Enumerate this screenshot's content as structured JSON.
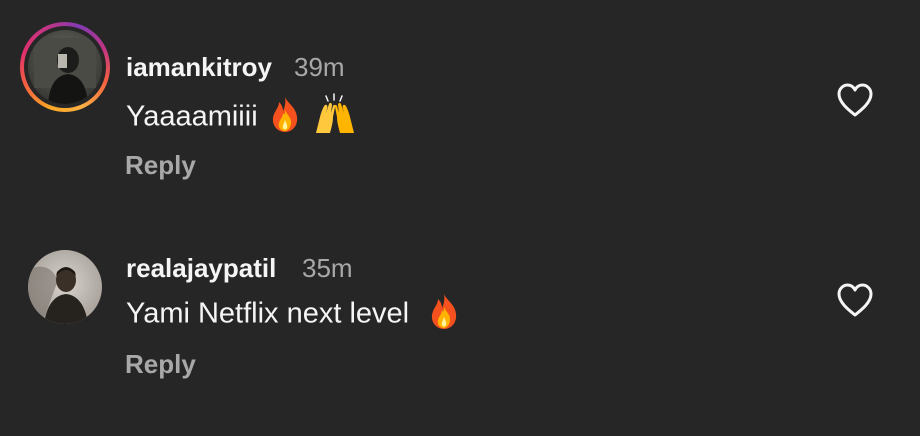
{
  "comments": [
    {
      "username": "iamankitroy",
      "time": "39m",
      "text": "Yaaaamiiii",
      "emojis": [
        "fire-emoji",
        "raising-hands-emoji"
      ],
      "reply_label": "Reply",
      "has_story_ring": true
    },
    {
      "username": "realajaypatil",
      "time": "35m",
      "text": "Yami Netflix next level",
      "emojis": [
        "fire-emoji"
      ],
      "reply_label": "Reply",
      "has_story_ring": false
    }
  ],
  "icons": {
    "like": "heart-outline-icon"
  },
  "colors": {
    "background": "#262626",
    "primary_text": "#f5f5f5",
    "secondary_text": "#a8a8a8"
  }
}
